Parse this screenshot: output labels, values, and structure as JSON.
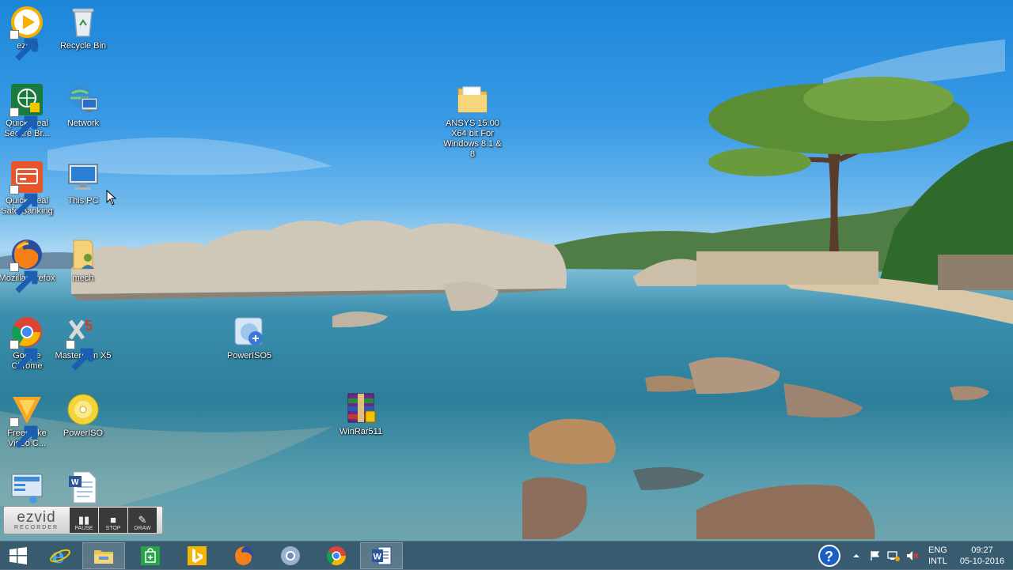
{
  "desktop": {
    "icons": [
      {
        "label": "ezvid"
      },
      {
        "label": "Recycle Bin"
      },
      {
        "label": "Quick Heal Secure Br..."
      },
      {
        "label": "Network"
      },
      {
        "label": "Quick Heal Safe Banking"
      },
      {
        "label": "This PC"
      },
      {
        "label": "Mozilla Firefox"
      },
      {
        "label": "mech"
      },
      {
        "label": "Google Chrome"
      },
      {
        "label": "Mastercam X5"
      },
      {
        "label": "Freemake Video C..."
      },
      {
        "label": "PowerISO"
      },
      {
        "label": "ANSYS 15.00 X64 bit For Windows 8.1 & 8"
      },
      {
        "label": "PowerISO5"
      },
      {
        "label": "WinRar511"
      }
    ]
  },
  "ezvid_recorder": {
    "brand": "ezvid",
    "sub": "RECORDER",
    "pause": "PAUSE",
    "stop": "STOP",
    "draw": "DRAW"
  },
  "taskbar": {
    "apps": [
      "start",
      "internet-explorer",
      "file-explorer",
      "store",
      "bing",
      "firefox",
      "chrome-2",
      "chrome",
      "word"
    ],
    "tray": {
      "lang_top": "ENG",
      "lang_bottom": "INTL",
      "time": "09:27",
      "date": "05-10-2016"
    }
  },
  "colors": {
    "sky": "#2b8ee0",
    "taskbar": "#2f4f68",
    "word_blue": "#2b579a",
    "quickheal_green": "#1b7a3e",
    "quickheal_orange": "#e8542b"
  }
}
